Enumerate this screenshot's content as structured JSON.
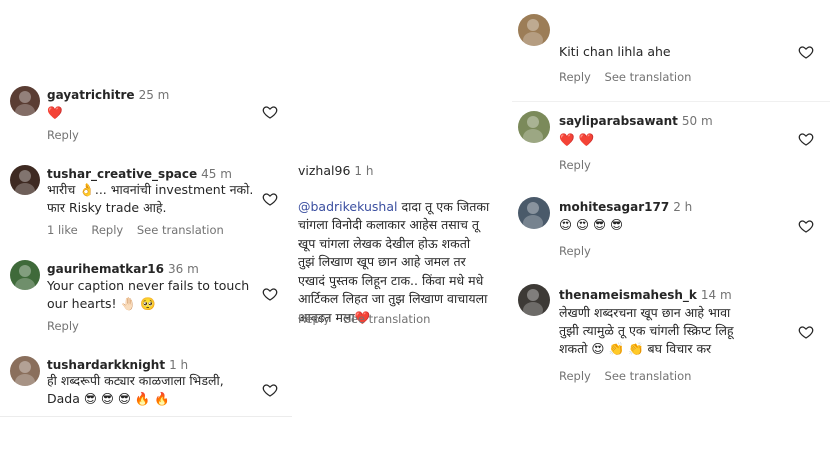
{
  "colors": {
    "accent_heart": "#ed4956",
    "secondary_text": "#737373",
    "mention": "#3b4fa0"
  },
  "icons": {
    "like": "heart-outline-icon"
  },
  "panel_left": {
    "comments": [
      {
        "username": "gayatrichitre",
        "time": "25 m",
        "text": "❤️",
        "actions": [
          "Reply"
        ]
      },
      {
        "username": "tushar_creative_space",
        "time": "45 m",
        "text": "भारीच 👌... भावनांची investment नको.\nफार Risky trade आहे.",
        "actions": [
          "1 like",
          "Reply",
          "See translation"
        ]
      },
      {
        "username": "gaurihematkar16",
        "time": "36 m",
        "text": "Your caption never fails to touch\nour hearts! 🤚🏻 🥺",
        "actions": [
          "Reply"
        ]
      },
      {
        "username": "tushardarkknight",
        "time": "1 h",
        "text": "ही शब्दरूपी कट्यार काळजाला भिडली,\nDada 😎 😎 😎 🔥 🔥",
        "actions": []
      }
    ]
  },
  "panel_middle": {
    "username": "vizhal96",
    "time": "1 h",
    "mention": "@badrikekushal",
    "text_first": " दादा तू एक जितका",
    "text_rest": "चांगला विनोदी कलाकार आहेस तसाच तू\nखूप चांगला लेखक देखील होऊ शकतो\nतुझं लिखाण खूप छान आहे जमल तर\nएखादं पुस्तक लिहून टाक.. किंवा मधे मधे\nआर्टिकल लिहत जा तुझ लिखाण वाचायला\nआवडत मला❤️",
    "actions": [
      "Reply",
      "See translation"
    ]
  },
  "panel_right": {
    "comments": [
      {
        "username": "",
        "time": "",
        "text": "Kiti chan lihla ahe",
        "actions": [
          "Reply",
          "See translation"
        ]
      },
      {
        "username": "sayliparabsawant",
        "time": "50 m",
        "text": "❤️ ❤️",
        "actions": [
          "Reply"
        ]
      },
      {
        "username": "mohitesagar177",
        "time": "2 h",
        "text": "😍 😍 😎 😎",
        "actions": [
          "Reply"
        ]
      },
      {
        "username": "thenameismahesh_k",
        "time": "14 m",
        "text": "लेखणी शब्दरचना खूप छान आहे भावा\nतुझी त्यामुळे तू एक चांगली स्क्रिप्ट लिहू\nशकतो 😍 👏 👏 बघ विचार कर",
        "actions": [
          "Reply",
          "See translation"
        ]
      }
    ]
  }
}
